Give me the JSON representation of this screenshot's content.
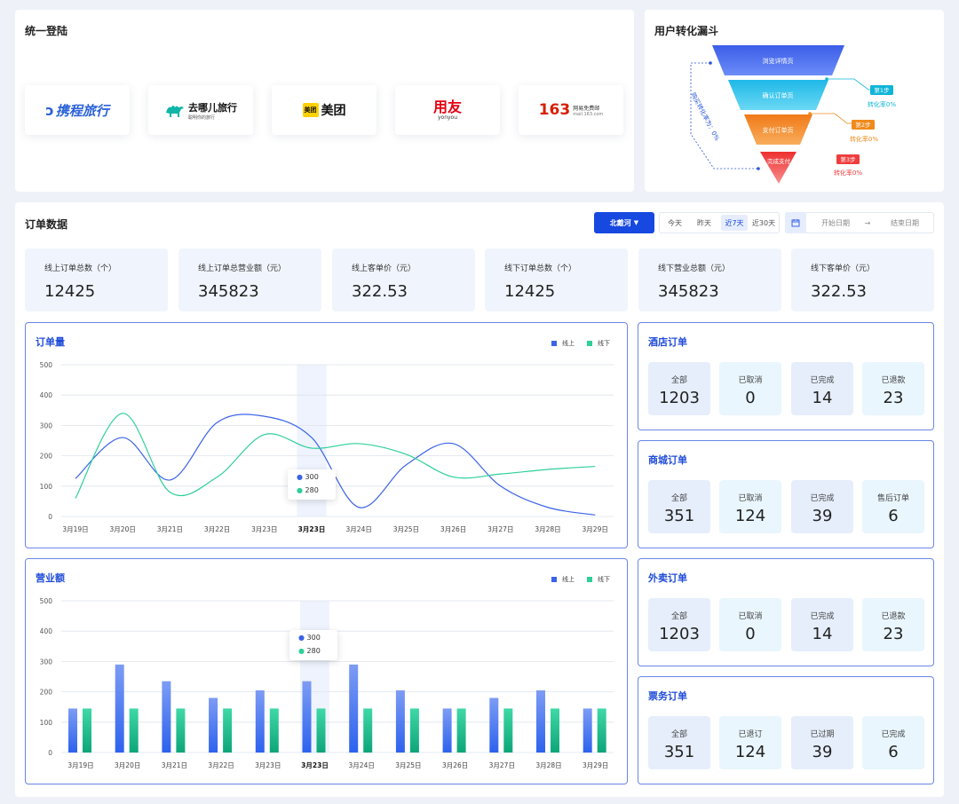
{
  "login": {
    "title": "统一登陆",
    "logos": [
      {
        "name": "ctrip",
        "text": "携程旅行",
        "color": "#2a62d8"
      },
      {
        "name": "qunar",
        "text": "去哪儿旅行",
        "sub": "聪明你的旅行",
        "color": "#111111"
      },
      {
        "name": "meituan",
        "text": "美团",
        "badge": "美团",
        "color": "#111111",
        "badge_color": "#ffd100"
      },
      {
        "name": "yonyou",
        "text": "用友",
        "sub": "yonyou",
        "color": "#e60012"
      },
      {
        "name": "163",
        "text": "163",
        "sub1": "网易免费邮",
        "sub2": "mail.163.com",
        "color": "#d81e06"
      }
    ]
  },
  "funnel": {
    "title": "用户转化漏斗",
    "stages": [
      "浏览详情页",
      "确认订单页",
      "支付订单页",
      "完成支付"
    ],
    "steps": [
      {
        "label": "第1步",
        "rate": "转化率0%",
        "color": "#10b5d8"
      },
      {
        "label": "第2步",
        "rate": "转化率0%",
        "color": "#f08a1c"
      },
      {
        "label": "第3步",
        "rate": "转化率0%",
        "color": "#ee3d3d"
      }
    ],
    "side_label": "购买转化率为：0%"
  },
  "orders": {
    "title": "订单数据",
    "region": "北戴河",
    "ranges": [
      "今天",
      "昨天",
      "近7天",
      "近30天"
    ],
    "active_range": "近7天",
    "start_placeholder": "开始日期",
    "end_placeholder": "结束日期",
    "arrow": "→",
    "stats": [
      {
        "label": "线上订单总数（个）",
        "value": "12425"
      },
      {
        "label": "线上订单总营业额（元）",
        "value": "345823"
      },
      {
        "label": "线上客单价（元）",
        "value": "322.53"
      },
      {
        "label": "线下订单总数（个）",
        "value": "12425"
      },
      {
        "label": "线下营业总额（元）",
        "value": "345823"
      },
      {
        "label": "线下客单价（元）",
        "value": "322.53"
      }
    ]
  },
  "colors": {
    "online": "#3a63e8",
    "offline": "#2ecf9a",
    "accent": "#1748e0"
  },
  "line_chart": {
    "title": "订单量",
    "legend": [
      "线上",
      "线下"
    ],
    "tooltip": [
      "300",
      "280"
    ]
  },
  "bar_chart": {
    "title": "营业额",
    "legend": [
      "线上",
      "线下"
    ],
    "tooltip": [
      "300",
      "280"
    ]
  },
  "chart_data": [
    {
      "type": "line",
      "title": "订单量",
      "categories": [
        "3月19日",
        "3月20日",
        "3月21日",
        "3月22日",
        "3月23日",
        "3月23日",
        "3月24日",
        "3月25日",
        "3月26日",
        "3月27日",
        "3月28日",
        "3月29日"
      ],
      "highlight_index": 5,
      "ylim": [
        0,
        500
      ],
      "yticks": [
        0,
        100,
        200,
        300,
        400,
        500
      ],
      "series": [
        {
          "name": "线上",
          "values": [
            125,
            260,
            120,
            310,
            330,
            260,
            30,
            170,
            240,
            100,
            30,
            5
          ]
        },
        {
          "name": "线下",
          "values": [
            60,
            340,
            80,
            130,
            270,
            225,
            240,
            205,
            130,
            140,
            155,
            165
          ]
        }
      ]
    },
    {
      "type": "bar",
      "title": "营业额",
      "categories": [
        "3月19日",
        "3月20日",
        "3月21日",
        "3月22日",
        "3月23日",
        "3月23日",
        "3月24日",
        "3月25日",
        "3月26日",
        "3月27日",
        "3月28日",
        "3月29日"
      ],
      "highlight_index": 5,
      "ylim": [
        0,
        500
      ],
      "yticks": [
        0,
        100,
        200,
        300,
        400,
        500
      ],
      "series": [
        {
          "name": "线上",
          "values": [
            145,
            290,
            235,
            180,
            205,
            235,
            290,
            205,
            145,
            180,
            205,
            145
          ]
        },
        {
          "name": "线下",
          "values": [
            145,
            145,
            145,
            145,
            145,
            145,
            145,
            145,
            145,
            145,
            145,
            145
          ]
        }
      ]
    }
  ],
  "order_groups": [
    {
      "title": "酒店订单",
      "items": [
        {
          "label": "全部",
          "value": "1203"
        },
        {
          "label": "已取消",
          "value": "0"
        },
        {
          "label": "已完成",
          "value": "14"
        },
        {
          "label": "已退款",
          "value": "23"
        }
      ]
    },
    {
      "title": "商城订单",
      "items": [
        {
          "label": "全部",
          "value": "351"
        },
        {
          "label": "已取消",
          "value": "124"
        },
        {
          "label": "已完成",
          "value": "39"
        },
        {
          "label": "售后订单",
          "value": "6"
        }
      ]
    },
    {
      "title": "外卖订单",
      "items": [
        {
          "label": "全部",
          "value": "1203"
        },
        {
          "label": "已取消",
          "value": "0"
        },
        {
          "label": "已完成",
          "value": "14"
        },
        {
          "label": "已退款",
          "value": "23"
        }
      ]
    },
    {
      "title": "票务订单",
      "items": [
        {
          "label": "全部",
          "value": "351"
        },
        {
          "label": "已退订",
          "value": "124"
        },
        {
          "label": "已过期",
          "value": "39"
        },
        {
          "label": "已完成",
          "value": "6"
        }
      ]
    }
  ]
}
